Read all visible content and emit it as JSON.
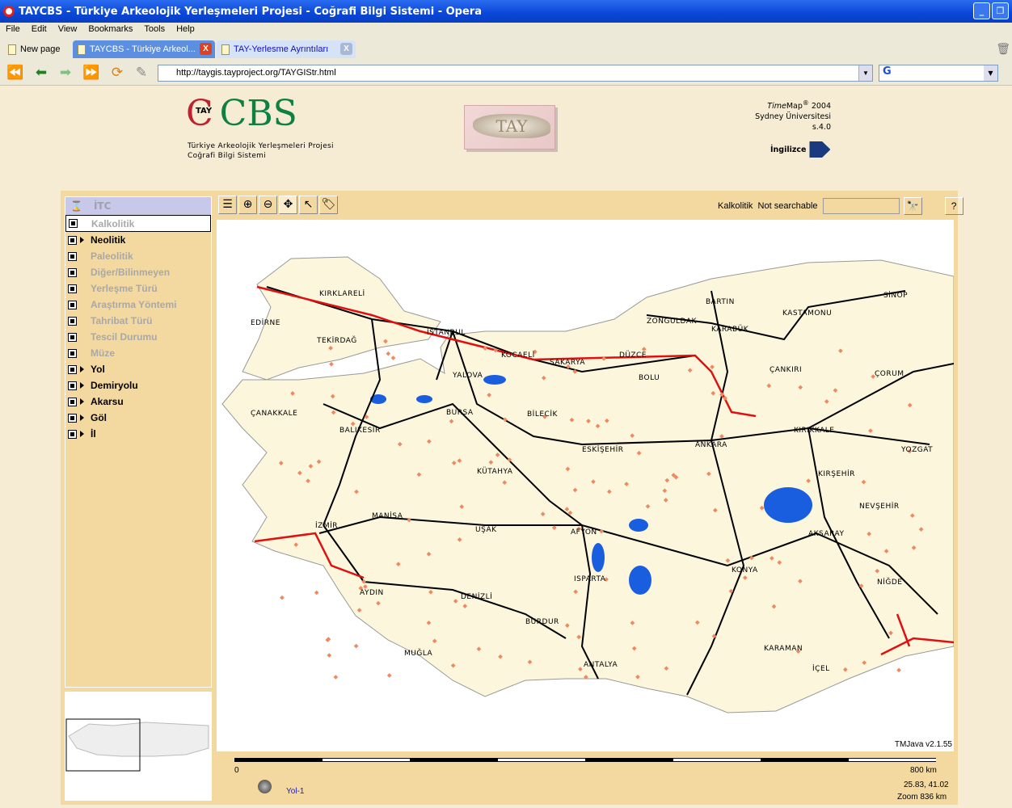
{
  "window": {
    "title": "TAYCBS - Türkiye Arkeolojik Yerleşmeleri Projesi - Coğrafi Bilgi Sistemi - Opera"
  },
  "menu": [
    "File",
    "Edit",
    "View",
    "Bookmarks",
    "Tools",
    "Help"
  ],
  "tabs": [
    {
      "label": "New page"
    },
    {
      "label": "TAYCBS - Türkiye Arkeol...",
      "active": true
    },
    {
      "label": "TAY-Yerlesme Ayrıntıları"
    }
  ],
  "address": {
    "url": "http://taygis.tayproject.org/TAYGIStr.html",
    "search_engine": "G"
  },
  "header": {
    "logo_small": "TAY",
    "logo_big": "CBS",
    "subtitle1": "Türkiye Arkeolojik Yerleşmeleri Projesi",
    "subtitle2": "Coğrafi Bilgi Sistemi",
    "image_text": "TAY",
    "credit_italic": "Time",
    "credit_map": "Map",
    "credit_sup": "®",
    "credit_year": " 2004",
    "credit_uni": "Sydney Üniversitesi",
    "credit_ver": "s.4.0",
    "lang_link": "İngilizce"
  },
  "layers": {
    "head": "İTC",
    "items": [
      {
        "label": "Kalkolitik",
        "state": "selected"
      },
      {
        "label": "Neolitik",
        "state": "on",
        "expand": true
      },
      {
        "label": "Paleolitik",
        "state": "off"
      },
      {
        "label": "Diğer/Bilinmeyen",
        "state": "off"
      },
      {
        "label": "Yerleşme Türü",
        "state": "off"
      },
      {
        "label": "Araştırma Yöntemi",
        "state": "off"
      },
      {
        "label": "Tahribat Türü",
        "state": "off"
      },
      {
        "label": "Tescil Durumu",
        "state": "off"
      },
      {
        "label": "Müze",
        "state": "off"
      },
      {
        "label": "Yol",
        "state": "on",
        "expand": true
      },
      {
        "label": "Demiryolu",
        "state": "on",
        "expand": true
      },
      {
        "label": "Akarsu",
        "state": "on",
        "expand": true
      },
      {
        "label": "Göl",
        "state": "on",
        "expand": true
      },
      {
        "label": "İl",
        "state": "on",
        "expand": true
      }
    ]
  },
  "toolbar": {
    "tools": [
      "layers-icon",
      "zoom-in-icon",
      "zoom-out-icon",
      "pan-icon",
      "select-icon",
      "label-icon"
    ],
    "active_layer": "Kalkolitik",
    "search_status": "Not searchable",
    "search_value": ""
  },
  "map": {
    "version": "TMJava v2.1.55",
    "cities": [
      "KIRKLARELİ",
      "EDİRNE",
      "TEKİRDAĞ",
      "İSTANBUL",
      "KOCAELİ",
      "SAKARYA",
      "DÜZCE",
      "BOLU",
      "ZONGULDAK",
      "BARTIN",
      "KARABÜK",
      "KASTAMONU",
      "SİNOP",
      "ÇANKIRI",
      "ÇORUM",
      "YALOVA",
      "BURSA",
      "BİLECİK",
      "ÇANAKKALE",
      "BALIKESİR",
      "ESKİŞEHİR",
      "ANKARA",
      "KIRIKKALE",
      "YOZGAT",
      "KÜTAHYA",
      "KIRŞEHİR",
      "NEVŞEHİR",
      "MANİSA",
      "İZMİR",
      "UŞAK",
      "AFYON",
      "AKSARAY",
      "KONYA",
      "NİĞDE",
      "ISPARTA",
      "AYDIN",
      "DENİZLİ",
      "BURDUR",
      "KARAMAN",
      "MUĞLA",
      "ANTALYA",
      "İÇEL"
    ],
    "colors": {
      "land": "#fbf6dc",
      "water": "#1a5ee0",
      "road": "#000000",
      "highway": "#e01010",
      "site": "#f08860"
    }
  },
  "scale": {
    "min": "0",
    "max": "800 km"
  },
  "status": {
    "layer": "Yol-1",
    "coords": "25.83, 41.02",
    "zoom": "Zoom  836 km"
  }
}
